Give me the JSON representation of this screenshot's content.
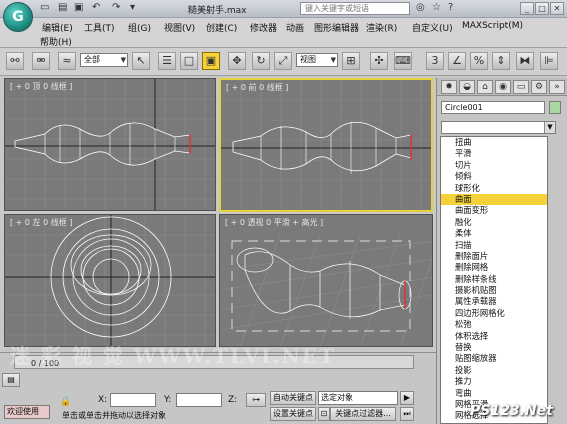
{
  "app": {
    "title": "糙美射手.max",
    "logo_letter": "G",
    "search_placeholder": "键入关键字或短语",
    "quick_access_icons": [
      "new-file-icon",
      "open-icon",
      "save-icon",
      "undo-icon",
      "redo-icon",
      "dropdown-icon"
    ]
  },
  "menu": {
    "items": [
      "编辑(E)",
      "工具(T)",
      "组(G)",
      "视图(V)",
      "创建(C)",
      "修改器",
      "动画",
      "图形编辑器",
      "渲染(R)",
      "自定义(U)",
      "MAXScript(M)"
    ],
    "help": "帮助(H)"
  },
  "toolbar": {
    "selection_filter": "全部",
    "ref_coord": "视图",
    "percent_value": "3",
    "active_tool": "rect-select-region-icon"
  },
  "viewports": [
    {
      "label": "[ + 0 顶 0 线框 ]"
    },
    {
      "label": "[ + 0 前 0 线框 ]",
      "active": true
    },
    {
      "label": "[ + 0 左 0 线框 ]"
    },
    {
      "label": "[ + 0 透视 0 平滑 + 高光 ]"
    }
  ],
  "command_panel": {
    "object_name": "Circle001",
    "object_color": "#a8d8a0",
    "modifier_list_value": "",
    "modifiers": [
      "扭曲",
      "平滑",
      "切片",
      "倾斜",
      "球形化",
      "曲面",
      "曲面变形",
      "融化",
      "柔体",
      "扫描",
      "删除面片",
      "删除网格",
      "删除样条线",
      "摄影机贴图",
      "属性承载器",
      "四边形网格化",
      "松弛",
      "体积选择",
      "替换",
      "贴图缩放器",
      "投影",
      "推力",
      "弯曲",
      "网格平滑",
      "网格选择"
    ],
    "selected_modifier": "曲面"
  },
  "status": {
    "frame": "0 / 100",
    "welcome": "欢迎使用",
    "prompt": "单击或单击并拖动以选择对象",
    "x_label": "X:",
    "y_label": "Y:",
    "z_label": "Z:",
    "auto_key": "自动关键点",
    "set_key": "设置关键点",
    "key_filter": "关键点过滤器...",
    "selected_object": "选定对象"
  },
  "watermarks": {
    "site": "PS123.Net",
    "left": "迷   彩   视   觉   WWW.TLVI.NET"
  }
}
